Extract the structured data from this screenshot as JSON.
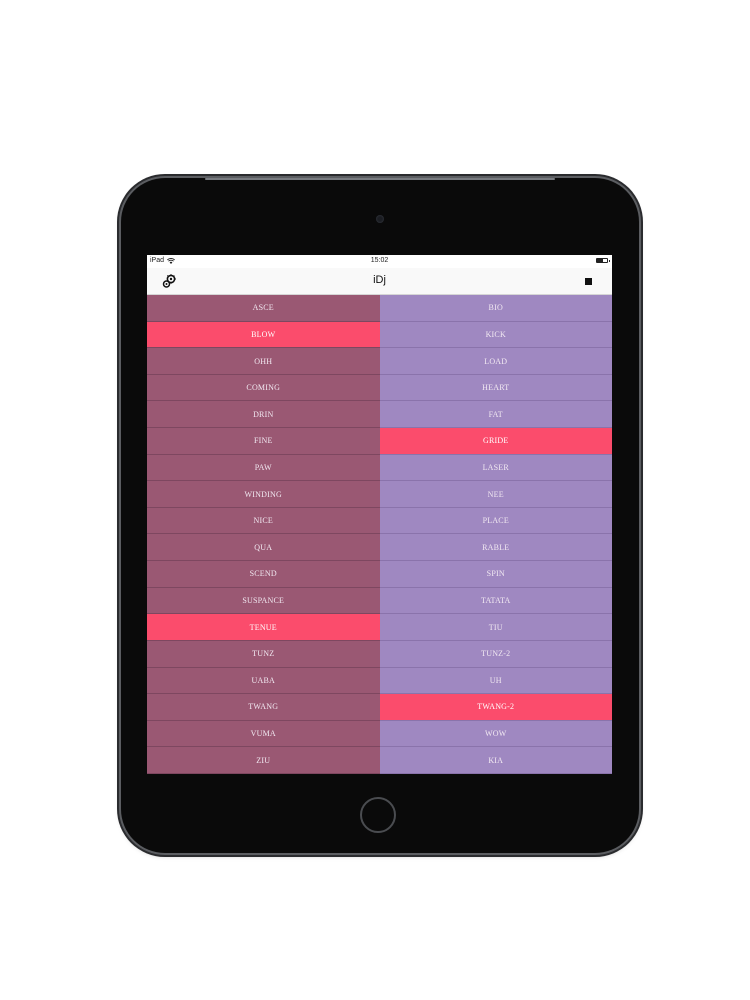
{
  "status_bar": {
    "device": "iPad",
    "time": "15:02"
  },
  "nav": {
    "title": "iDj",
    "left_icon": "settings-gears-icon",
    "right_icon": "stop-icon"
  },
  "colors": {
    "left_column": "#9a5873",
    "right_column": "#9f88c1",
    "active_pad": "#fb4c6c"
  },
  "pads": {
    "left": [
      {
        "label": "ASCE",
        "active": false
      },
      {
        "label": "BLOW",
        "active": true
      },
      {
        "label": "OHH",
        "active": false
      },
      {
        "label": "COMING",
        "active": false
      },
      {
        "label": "DRIN",
        "active": false
      },
      {
        "label": "FINE",
        "active": false
      },
      {
        "label": "PAW",
        "active": false
      },
      {
        "label": "WINDING",
        "active": false
      },
      {
        "label": "NICE",
        "active": false
      },
      {
        "label": "QUA",
        "active": false
      },
      {
        "label": "SCEND",
        "active": false
      },
      {
        "label": "SUSPANCE",
        "active": false
      },
      {
        "label": "TENUE",
        "active": true
      },
      {
        "label": "TUNZ",
        "active": false
      },
      {
        "label": "UABA",
        "active": false
      },
      {
        "label": "TWANG",
        "active": false
      },
      {
        "label": "VUMA",
        "active": false
      },
      {
        "label": "ZIU",
        "active": false
      }
    ],
    "right": [
      {
        "label": "BIO",
        "active": false
      },
      {
        "label": "KICK",
        "active": false
      },
      {
        "label": "LOAD",
        "active": false
      },
      {
        "label": "HEART",
        "active": false
      },
      {
        "label": "FAT",
        "active": false
      },
      {
        "label": "GRIDE",
        "active": true
      },
      {
        "label": "LASER",
        "active": false
      },
      {
        "label": "NEE",
        "active": false
      },
      {
        "label": "PLACE",
        "active": false
      },
      {
        "label": "RABLE",
        "active": false
      },
      {
        "label": "SPIN",
        "active": false
      },
      {
        "label": "TATATA",
        "active": false
      },
      {
        "label": "TIU",
        "active": false
      },
      {
        "label": "TUNZ-2",
        "active": false
      },
      {
        "label": "UH",
        "active": false
      },
      {
        "label": "TWANG-2",
        "active": true
      },
      {
        "label": "WOW",
        "active": false
      },
      {
        "label": "KIA",
        "active": false
      }
    ]
  }
}
